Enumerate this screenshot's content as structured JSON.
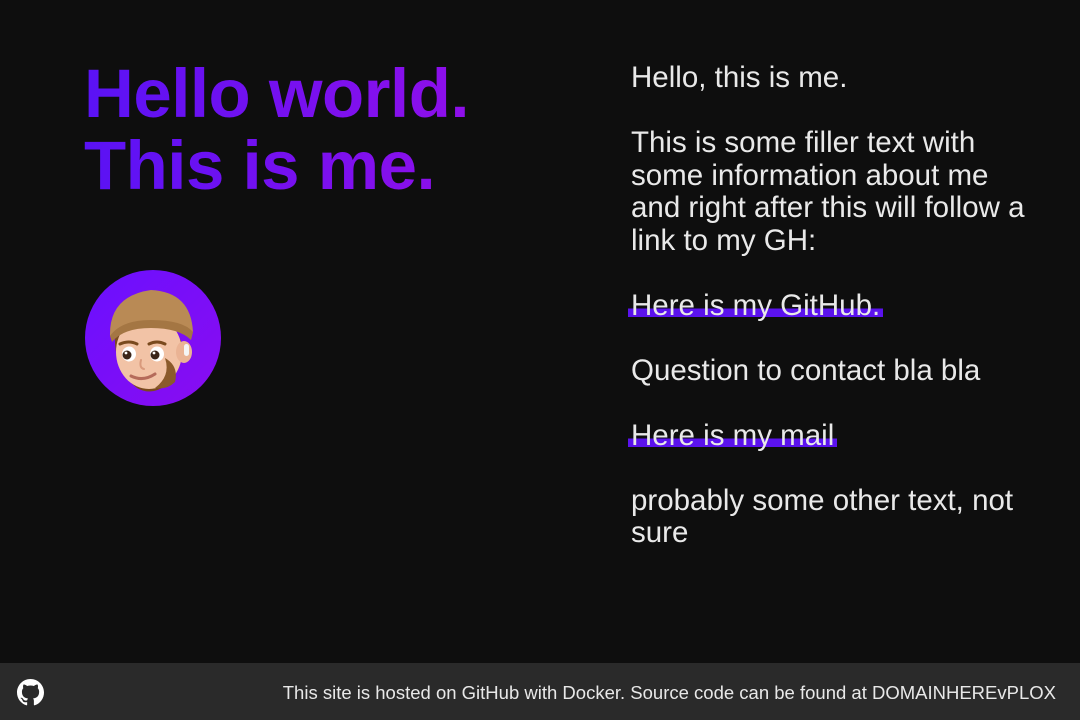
{
  "hero": {
    "line1": "Hello world.",
    "line2": "This is me."
  },
  "avatar": {
    "icon": "memoji-avatar"
  },
  "about": {
    "greeting": "Hello, this is me.",
    "filler": "This is some filler text with some information about me and right after this will follow a link to my GH:",
    "github_link": "Here is my GitHub.",
    "contact": "Question to contact bla bla",
    "mail_link": "Here is my mail",
    "other": "probably some other text, not sure"
  },
  "footer": {
    "icon": "github-icon",
    "text": "This site is hosted on GitHub with Docker. Source code can be found at DOMAINHEREvPLOX"
  },
  "colors": {
    "background": "#0e0e0e",
    "accent_start": "#5a12f5",
    "accent_end": "#8f0fea",
    "text": "#e9e9e9",
    "footer_bg": "#2a2a2a"
  }
}
